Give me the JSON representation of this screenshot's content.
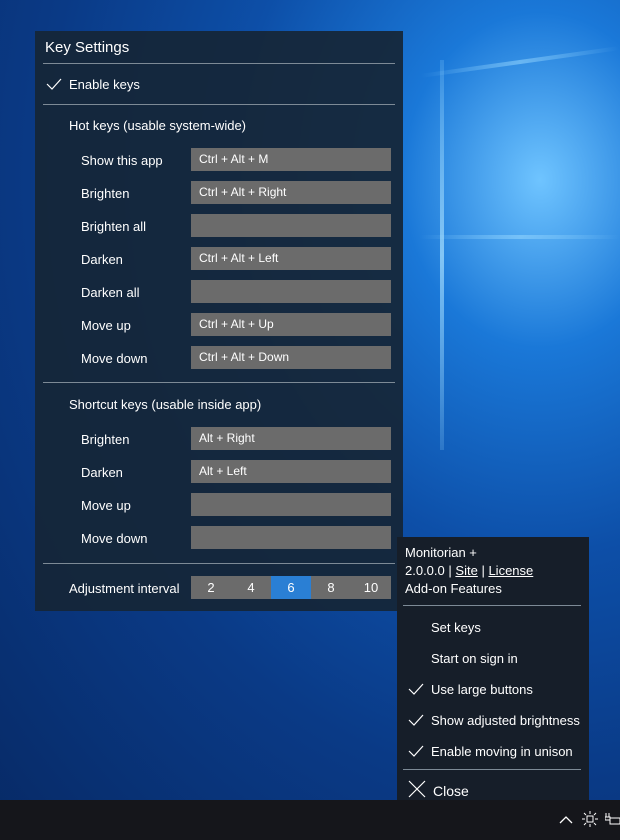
{
  "key_settings": {
    "title": "Key Settings",
    "enable_keys": {
      "label": "Enable keys",
      "checked": true
    },
    "hot_keys": {
      "heading": "Hot keys (usable system-wide)",
      "rows": [
        {
          "label": "Show this app",
          "value": "Ctrl + Alt + M"
        },
        {
          "label": "Brighten",
          "value": "Ctrl + Alt + Right"
        },
        {
          "label": "Brighten all",
          "value": ""
        },
        {
          "label": "Darken",
          "value": "Ctrl + Alt + Left"
        },
        {
          "label": "Darken all",
          "value": ""
        },
        {
          "label": "Move up",
          "value": "Ctrl + Alt + Up"
        },
        {
          "label": "Move down",
          "value": "Ctrl + Alt + Down"
        }
      ]
    },
    "shortcut_keys": {
      "heading": "Shortcut keys (usable inside app)",
      "rows": [
        {
          "label": "Brighten",
          "value": "Alt + Right"
        },
        {
          "label": "Darken",
          "value": "Alt + Left"
        },
        {
          "label": "Move up",
          "value": ""
        },
        {
          "label": "Move down",
          "value": ""
        }
      ]
    },
    "adjustment_interval": {
      "label": "Adjustment interval",
      "options": [
        "2",
        "4",
        "6",
        "8",
        "10"
      ],
      "selected": "6"
    }
  },
  "menu": {
    "app_name": "Monitorian +",
    "version": "2.0.0.0",
    "separator": "|",
    "site_link": "Site",
    "license_link": "License",
    "addon": "Add-on Features",
    "items": [
      {
        "label": "Set keys",
        "checked": false
      },
      {
        "label": "Start on sign in",
        "checked": false
      },
      {
        "label": "Use large buttons",
        "checked": true
      },
      {
        "label": "Show adjusted brightness",
        "checked": true
      },
      {
        "label": "Enable moving in unison",
        "checked": true
      }
    ],
    "close": "Close"
  },
  "colors": {
    "accent": "#2a7fd4",
    "field": "#6b6b6b"
  }
}
